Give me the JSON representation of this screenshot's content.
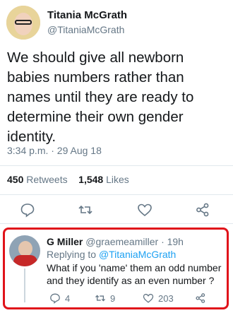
{
  "tweet": {
    "author_name": "Titania McGrath",
    "author_handle": "@TitaniaMcGrath",
    "text": "We should give all newborn babies numbers rather than names until they are ready to determine their own gender identity.",
    "timestamp": "3:34 p.m. · 29 Aug 18",
    "retweets_count": "450",
    "retweets_label": "Retweets",
    "likes_count": "1,548",
    "likes_label": "Likes"
  },
  "actions": [
    {
      "icon": "reply-icon"
    },
    {
      "icon": "retweet-icon"
    },
    {
      "icon": "like-icon"
    },
    {
      "icon": "share-icon"
    }
  ],
  "reply": {
    "author_name": "G Miller",
    "author_handle": "@graemeamiller",
    "time": "· 19h",
    "replying_prefix": "Replying to",
    "replying_to": "@TitaniaMcGrath",
    "text": "What if you 'name' them an odd number and they identify as an even number ?",
    "reply_count": "4",
    "retweet_count": "9",
    "like_count": "203"
  },
  "colors": {
    "accent": "#1da1f2",
    "highlight_border": "#e0131a",
    "secondary_text": "#657786"
  }
}
